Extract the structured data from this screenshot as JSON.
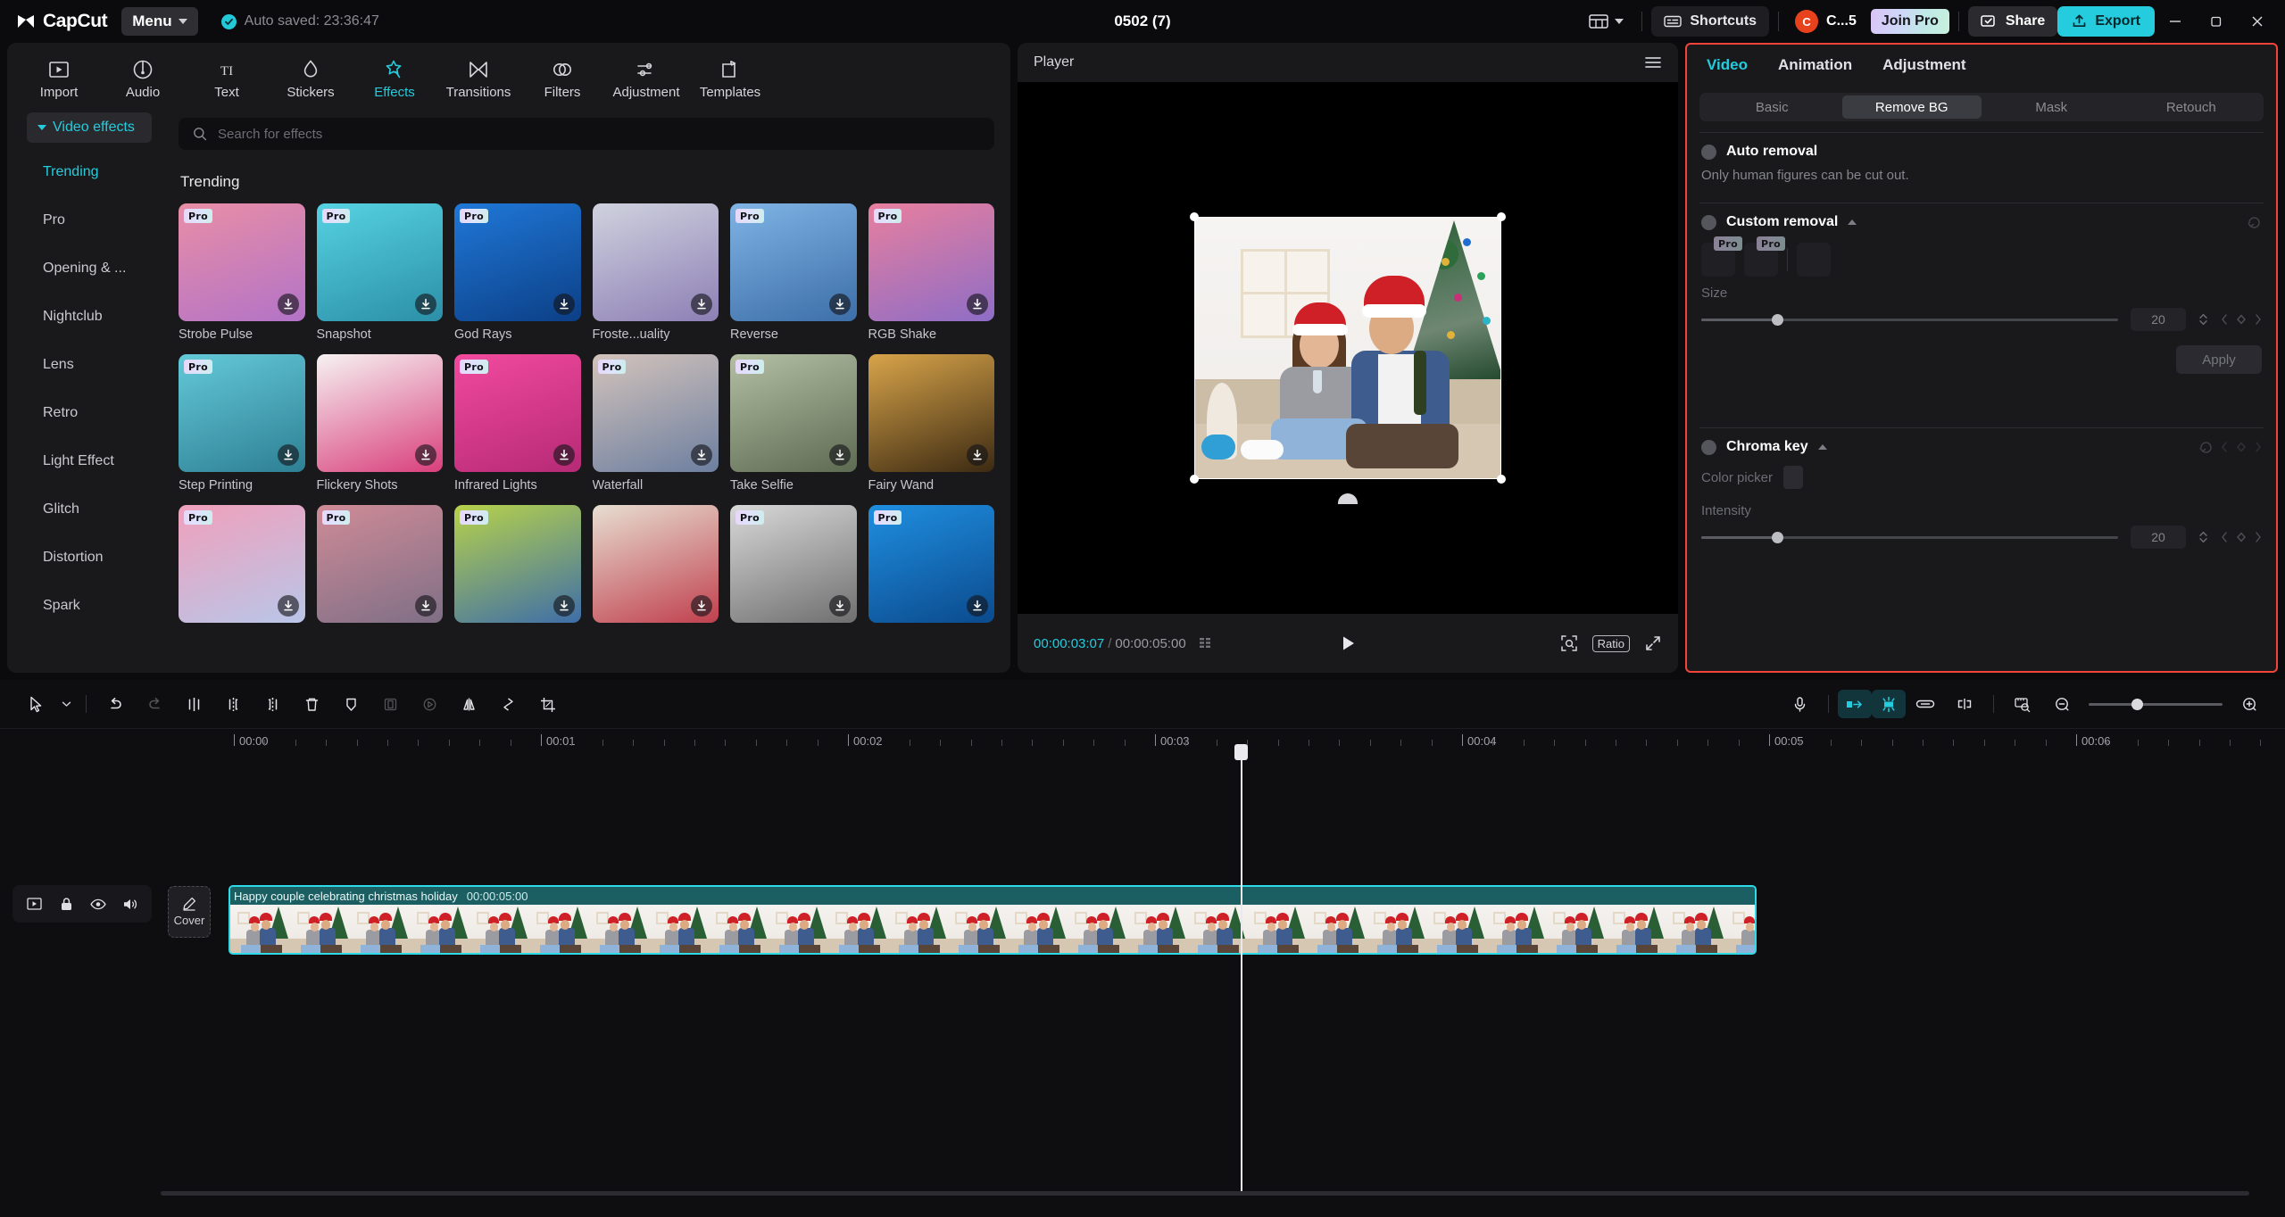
{
  "titlebar": {
    "brand": "CapCut",
    "menu_label": "Menu",
    "autosave_text": "Auto saved: 23:36:47",
    "project_title": "0502 (7)",
    "shortcuts_label": "Shortcuts",
    "account_initial": "C",
    "account_name": "C...5",
    "join_pro_label": "Join Pro",
    "share_label": "Share",
    "export_label": "Export",
    "accent_color": "#24ccdd",
    "export_bg": "#24ccdd"
  },
  "left_panel": {
    "tabs": [
      {
        "label": "Import",
        "icon": "import-icon",
        "active": false
      },
      {
        "label": "Audio",
        "icon": "audio-icon",
        "active": false
      },
      {
        "label": "Text",
        "icon": "text-icon",
        "active": false
      },
      {
        "label": "Stickers",
        "icon": "stickers-icon",
        "active": false
      },
      {
        "label": "Effects",
        "icon": "effects-icon",
        "active": true
      },
      {
        "label": "Transitions",
        "icon": "transitions-icon",
        "active": false
      },
      {
        "label": "Filters",
        "icon": "filters-icon",
        "active": false
      },
      {
        "label": "Adjustment",
        "icon": "adjustment-icon",
        "active": false
      },
      {
        "label": "Templates",
        "icon": "templates-icon",
        "active": false
      }
    ],
    "category_header": "Video effects",
    "categories": [
      {
        "label": "Trending",
        "active": true
      },
      {
        "label": "Pro",
        "active": false
      },
      {
        "label": "Opening & ...",
        "active": false
      },
      {
        "label": "Nightclub",
        "active": false
      },
      {
        "label": "Lens",
        "active": false
      },
      {
        "label": "Retro",
        "active": false
      },
      {
        "label": "Light Effect",
        "active": false
      },
      {
        "label": "Glitch",
        "active": false
      },
      {
        "label": "Distortion",
        "active": false
      },
      {
        "label": "Spark",
        "active": false
      }
    ],
    "search_placeholder": "Search for effects",
    "section_title": "Trending",
    "pro_badge": "Pro",
    "effects": [
      {
        "label": "Strobe Pulse",
        "pro": true,
        "c1": "#e98ea6",
        "c2": "#b273c7"
      },
      {
        "label": "Snapshot",
        "pro": true,
        "c1": "#56d2e2",
        "c2": "#2b8fa8"
      },
      {
        "label": "God Rays",
        "pro": true,
        "c1": "#1f78d8",
        "c2": "#0c3f86"
      },
      {
        "label": "Froste...uality",
        "pro": false,
        "c1": "#cfd2de",
        "c2": "#8d7fb5"
      },
      {
        "label": "Reverse",
        "pro": true,
        "c1": "#7fb4e5",
        "c2": "#3d6ea8"
      },
      {
        "label": "RGB Shake",
        "pro": true,
        "c1": "#e87f9e",
        "c2": "#8e6dc6"
      },
      {
        "label": "Step Printing",
        "pro": true,
        "c1": "#63c9d8",
        "c2": "#2e7f94"
      },
      {
        "label": "Flickery Shots",
        "pro": false,
        "c1": "#f6f2f2",
        "c2": "#d93f7c"
      },
      {
        "label": "Infrared Lights",
        "pro": true,
        "c1": "#f24a9e",
        "c2": "#b62a75"
      },
      {
        "label": "Waterfall",
        "pro": true,
        "c1": "#d3c3bb",
        "c2": "#6d7fa0"
      },
      {
        "label": "Take Selfie",
        "pro": true,
        "c1": "#b4bfa4",
        "c2": "#5d6b52"
      },
      {
        "label": "Fairy Wand",
        "pro": false,
        "c1": "#d8a44a",
        "c2": "#3c2a12"
      },
      {
        "label": "",
        "pro": true,
        "c1": "#f0a0bb",
        "c2": "#b9c6e8"
      },
      {
        "label": "",
        "pro": true,
        "c1": "#cf8b97",
        "c2": "#7f6f86"
      },
      {
        "label": "",
        "pro": true,
        "c1": "#b7d24a",
        "c2": "#3e6ea8"
      },
      {
        "label": "",
        "pro": false,
        "c1": "#e7ded1",
        "c2": "#c0404e"
      },
      {
        "label": "",
        "pro": true,
        "c1": "#d8d8d8",
        "c2": "#6f6f6f"
      },
      {
        "label": "",
        "pro": true,
        "c1": "#1f8fe0",
        "c2": "#0b4a8d"
      }
    ]
  },
  "player": {
    "title": "Player",
    "current_time": "00:00:03:07",
    "separator": "/",
    "duration": "00:00:05:00",
    "ratio_label": "Ratio"
  },
  "right_panel": {
    "tabs": [
      {
        "label": "Video",
        "active": true
      },
      {
        "label": "Animation",
        "active": false
      },
      {
        "label": "Adjustment",
        "active": false
      }
    ],
    "segments": [
      {
        "label": "Basic",
        "active": false
      },
      {
        "label": "Remove BG",
        "active": true
      },
      {
        "label": "Mask",
        "active": false
      },
      {
        "label": "Retouch",
        "active": false
      }
    ],
    "auto_removal": {
      "title": "Auto removal",
      "description": "Only human figures can be cut out."
    },
    "custom_removal": {
      "title": "Custom removal",
      "pro_badge": "Pro",
      "size_label": "Size",
      "size_value": "20",
      "apply_label": "Apply"
    },
    "chroma_key": {
      "title": "Chroma key",
      "color_picker_label": "Color picker",
      "intensity_label": "Intensity",
      "intensity_value": "20"
    },
    "highlight_border_color": "#f4443a"
  },
  "timeline": {
    "ruler_labels": [
      "00:00",
      "00:01",
      "00:02",
      "00:03",
      "00:04",
      "00:05",
      "00:06"
    ],
    "cover_label": "Cover",
    "clip": {
      "name": "Happy couple celebrating christmas holiday",
      "duration": "00:00:05:00",
      "border_color": "#2ed9e8"
    }
  }
}
